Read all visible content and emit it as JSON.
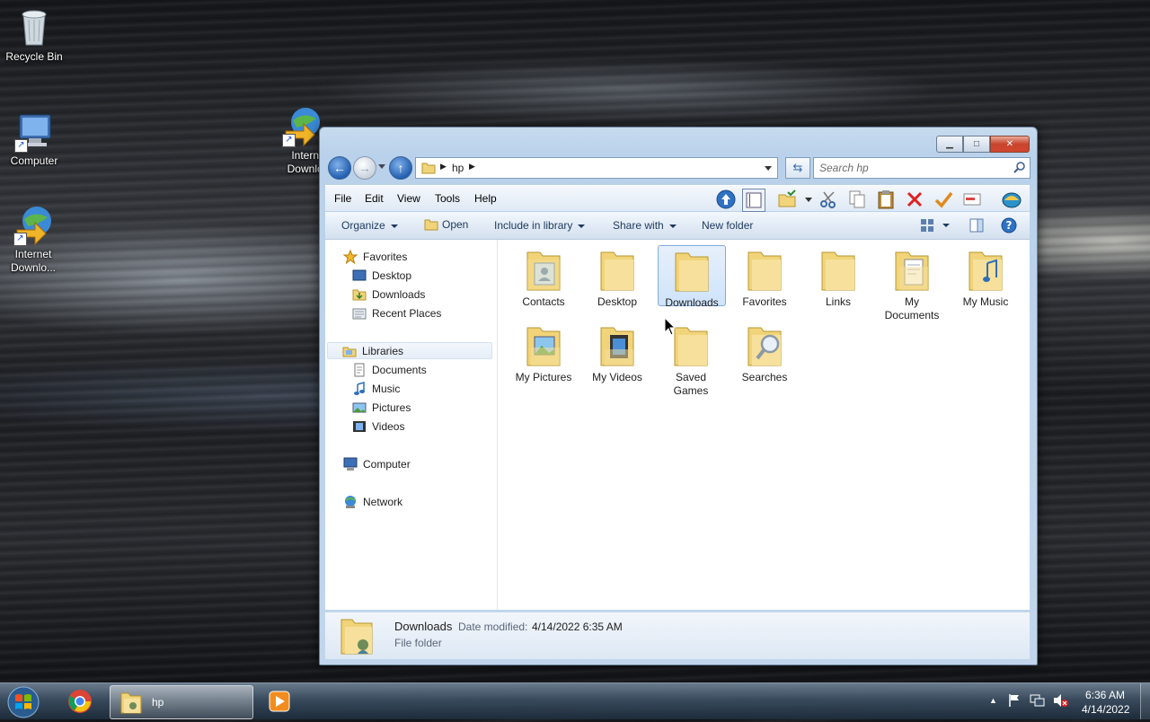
{
  "desktop": {
    "icons": [
      {
        "label": "Recycle Bin"
      },
      {
        "label": "Computer"
      },
      {
        "label": "Internet Downlo..."
      },
      {
        "label": "Interne Downloa"
      }
    ]
  },
  "window": {
    "breadcrumb": [
      "hp"
    ],
    "search_placeholder": "Search hp",
    "menu": [
      "File",
      "Edit",
      "View",
      "Tools",
      "Help"
    ],
    "commands": {
      "organize": "Organize",
      "open": "Open",
      "include": "Include in library",
      "share": "Share with",
      "new_folder": "New folder"
    },
    "nav": {
      "favorites": "Favorites",
      "fav_items": [
        "Desktop",
        "Downloads",
        "Recent Places"
      ],
      "libraries": "Libraries",
      "lib_items": [
        "Documents",
        "Music",
        "Pictures",
        "Videos"
      ],
      "computer": "Computer",
      "network": "Network"
    },
    "files": [
      {
        "name": "Contacts"
      },
      {
        "name": "Desktop"
      },
      {
        "name": "Downloads",
        "selected": true
      },
      {
        "name": "Favorites"
      },
      {
        "name": "Links"
      },
      {
        "name": "My Documents"
      },
      {
        "name": "My Music"
      },
      {
        "name": "My Pictures"
      },
      {
        "name": "My Videos"
      },
      {
        "name": "Saved Games"
      },
      {
        "name": "Searches"
      }
    ],
    "details": {
      "name": "Downloads",
      "modified_label": "Date modified:",
      "modified_value": "4/14/2022 6:35 AM",
      "type": "File folder"
    }
  },
  "taskbar": {
    "active_app_label": "hp",
    "time": "6:36 AM",
    "date": "4/14/2022"
  },
  "colors": {
    "accent": "#2460b0",
    "folder": "#f1d47a",
    "selection": "#cfe3fb"
  }
}
